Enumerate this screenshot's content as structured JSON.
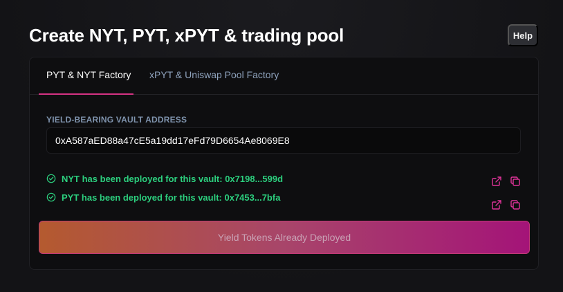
{
  "page": {
    "title": "Create NYT, PYT, xPYT & trading pool",
    "help_label": "Help"
  },
  "tabs": [
    {
      "label": "PYT & NYT Factory",
      "active": true
    },
    {
      "label": "xPYT & Uniswap Pool Factory",
      "active": false
    }
  ],
  "vault": {
    "label": "YIELD-BEARING VAULT ADDRESS",
    "value": "0xA587aED88a47cE5a19dd17eFd79D6654Ae8069E8",
    "placeholder": ""
  },
  "status": [
    {
      "text": "NYT has been deployed for this vault: 0x7198...599d",
      "icon": "check-circle-icon"
    },
    {
      "text": "PYT has been deployed for this vault: 0x7453...7bfa",
      "icon": "check-circle-icon"
    }
  ],
  "actions": {
    "external_link_icon": "external-link-icon",
    "copy_icon": "copy-icon"
  },
  "deploy_button": {
    "label": "Yield Tokens Already Deployed",
    "disabled": true
  },
  "colors": {
    "success": "#2ccf7e",
    "accent": "#d63384",
    "button_gradient_start": "#b45a2f",
    "button_gradient_end": "#a41478"
  }
}
